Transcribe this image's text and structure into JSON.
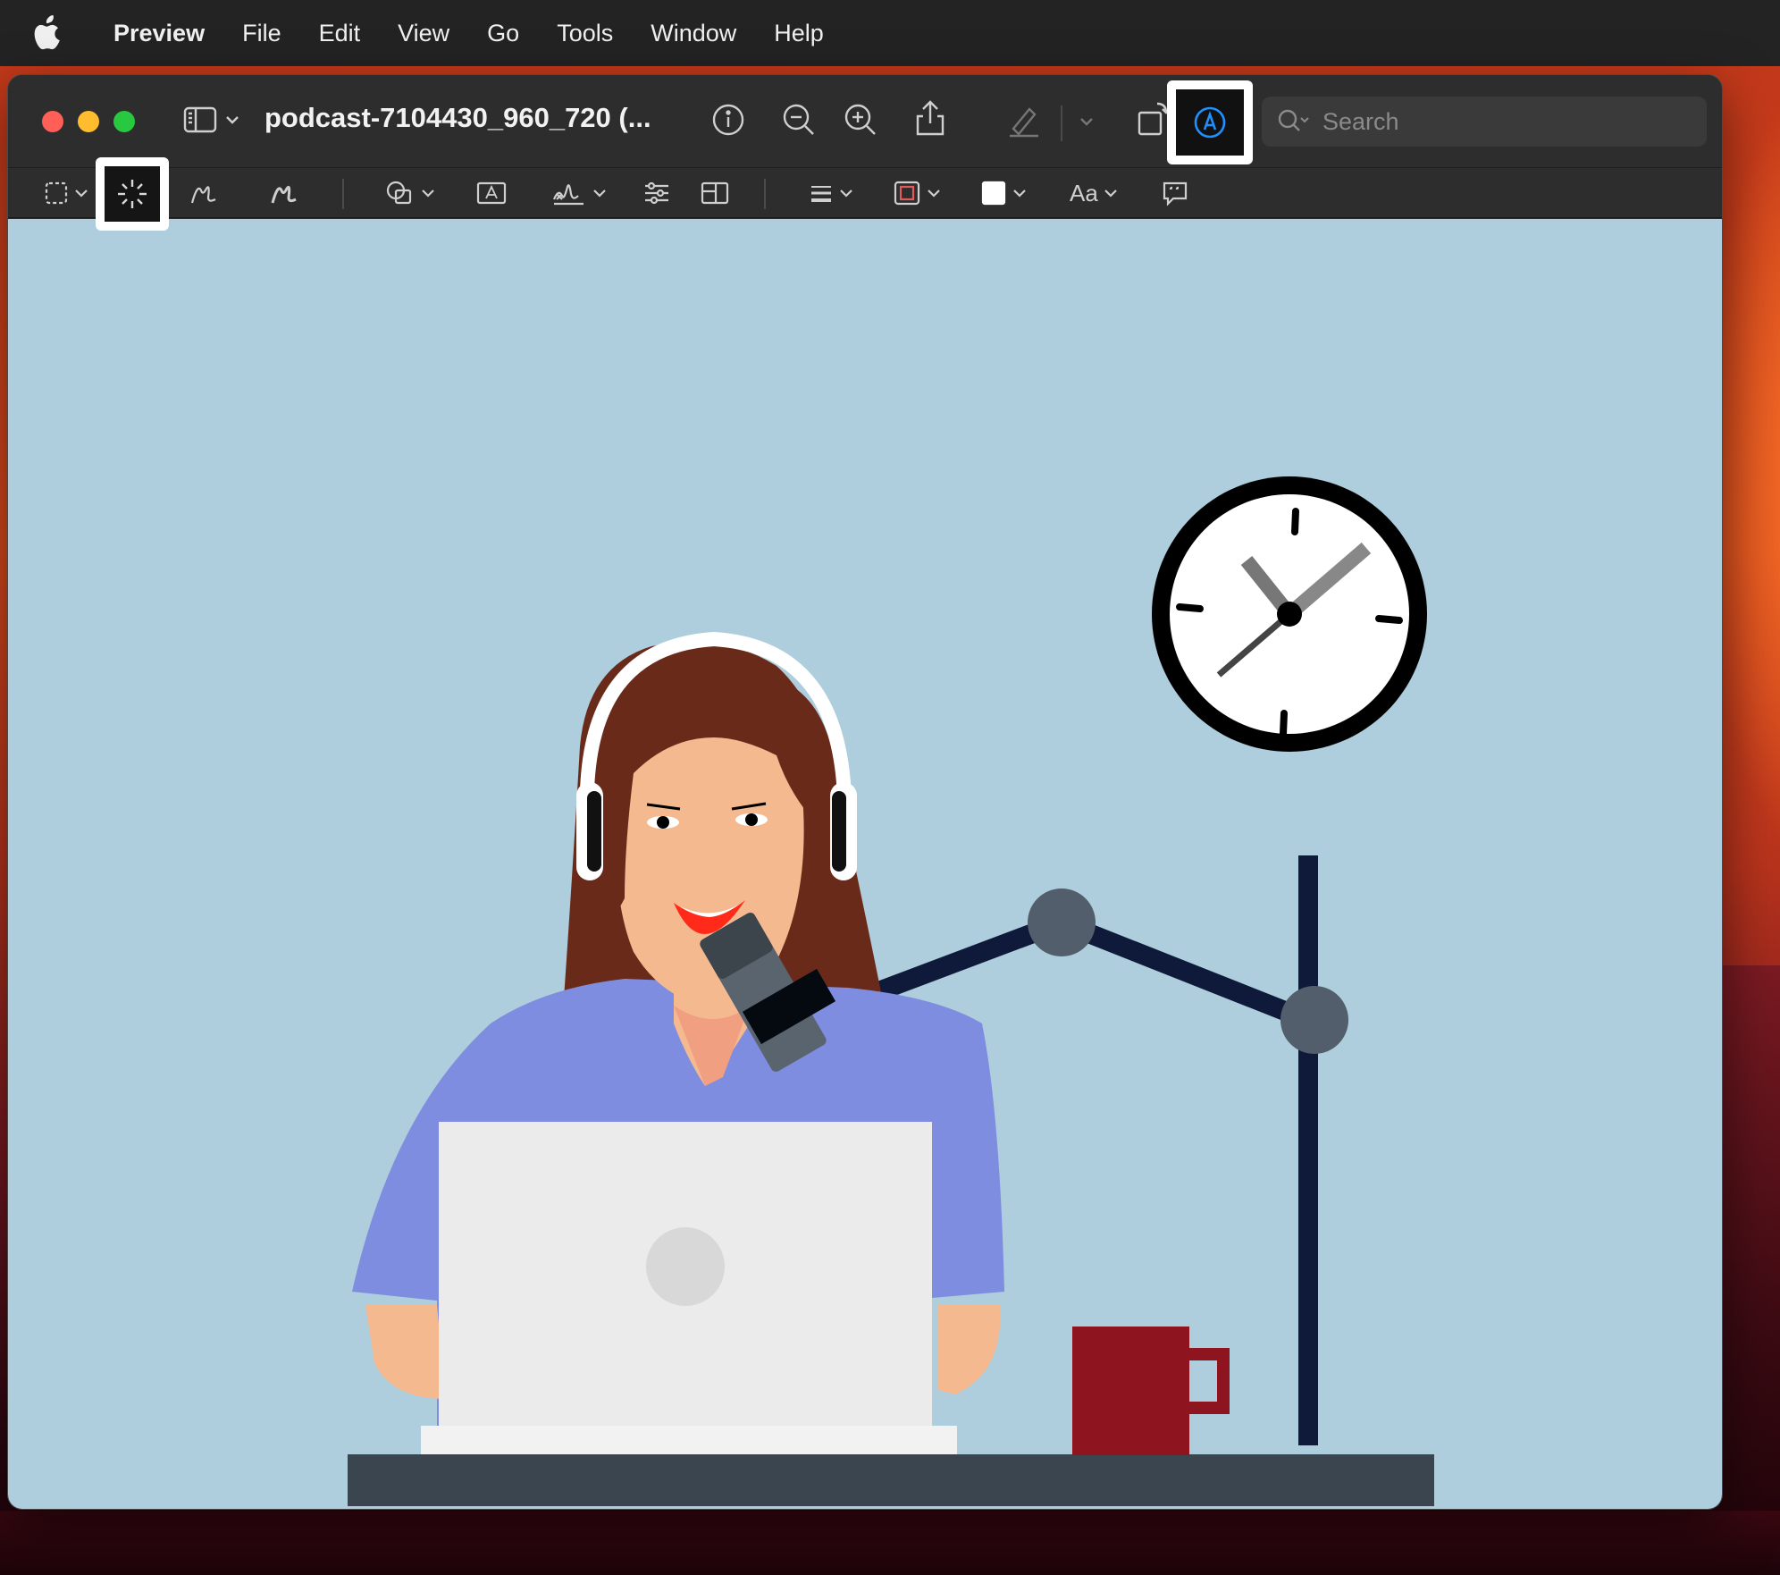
{
  "menubar": {
    "app_name": "Preview",
    "items": [
      "File",
      "Edit",
      "View",
      "Go",
      "Tools",
      "Window",
      "Help"
    ]
  },
  "window": {
    "title": "podcast-7104430_960_720 (...",
    "search": {
      "placeholder": "Search",
      "value": ""
    }
  },
  "toolbar": {
    "icons": [
      "sidebar-icon",
      "info-icon",
      "zoom-out-icon",
      "zoom-in-icon",
      "share-icon",
      "highlight-pen-icon",
      "rotate-icon",
      "markup-icon"
    ]
  },
  "markup_toolbar": {
    "font_label": "Aa",
    "icons": [
      "rect-selection-icon",
      "instant-alpha-icon",
      "sketch-icon",
      "draw-icon",
      "shapes-icon",
      "text-box-icon",
      "signature-icon",
      "adjust-color-icon",
      "adjust-size-icon",
      "line-style-icon",
      "border-color-icon",
      "fill-color-icon",
      "font-icon",
      "note-icon"
    ]
  },
  "colors": {
    "canvas_bg": "#aecddd",
    "markup_accent": "#1e90ff",
    "highlight_border": "#ffffff"
  }
}
